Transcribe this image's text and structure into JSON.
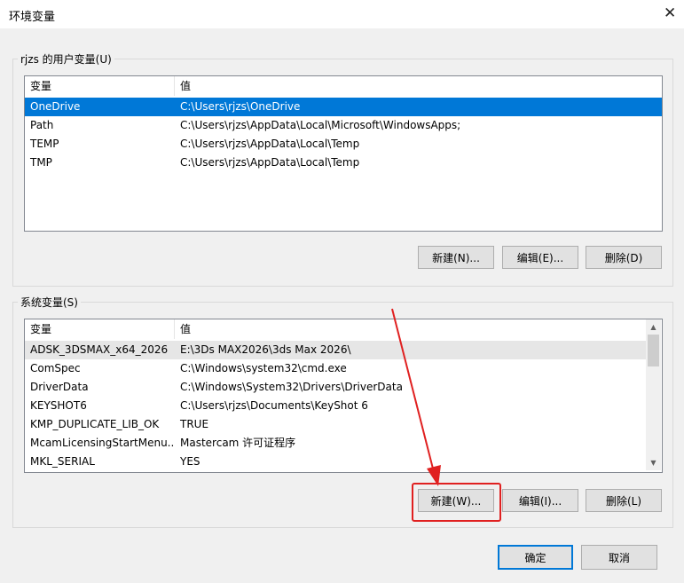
{
  "window": {
    "title": "环境变量",
    "close_glyph": "✕"
  },
  "user_vars": {
    "legend": "rjzs 的用户变量(U)",
    "columns": {
      "name": "变量",
      "value": "值"
    },
    "rows": [
      {
        "name": "OneDrive",
        "value": "C:\\Users\\rjzs\\OneDrive"
      },
      {
        "name": "Path",
        "value": "C:\\Users\\rjzs\\AppData\\Local\\Microsoft\\WindowsApps;"
      },
      {
        "name": "TEMP",
        "value": "C:\\Users\\rjzs\\AppData\\Local\\Temp"
      },
      {
        "name": "TMP",
        "value": "C:\\Users\\rjzs\\AppData\\Local\\Temp"
      }
    ],
    "buttons": {
      "new": "新建(N)...",
      "edit": "编辑(E)...",
      "delete": "删除(D)"
    }
  },
  "system_vars": {
    "legend": "系统变量(S)",
    "columns": {
      "name": "变量",
      "value": "值"
    },
    "rows": [
      {
        "name": "ADSK_3DSMAX_x64_2026",
        "value": "E:\\3Ds MAX2026\\3ds Max 2026\\"
      },
      {
        "name": "ComSpec",
        "value": "C:\\Windows\\system32\\cmd.exe"
      },
      {
        "name": "DriverData",
        "value": "C:\\Windows\\System32\\Drivers\\DriverData"
      },
      {
        "name": "KEYSHOT6",
        "value": "C:\\Users\\rjzs\\Documents\\KeyShot 6"
      },
      {
        "name": "KMP_DUPLICATE_LIB_OK",
        "value": "TRUE"
      },
      {
        "name": "McamLicensingStartMenu...",
        "value": "Mastercam 许可证程序"
      },
      {
        "name": "MKL_SERIAL",
        "value": "YES"
      }
    ],
    "buttons": {
      "new": "新建(W)...",
      "edit": "编辑(I)...",
      "delete": "删除(L)"
    }
  },
  "footer": {
    "ok": "确定",
    "cancel": "取消"
  },
  "colors": {
    "selection": "#0078d7",
    "annotation": "#e02020"
  }
}
